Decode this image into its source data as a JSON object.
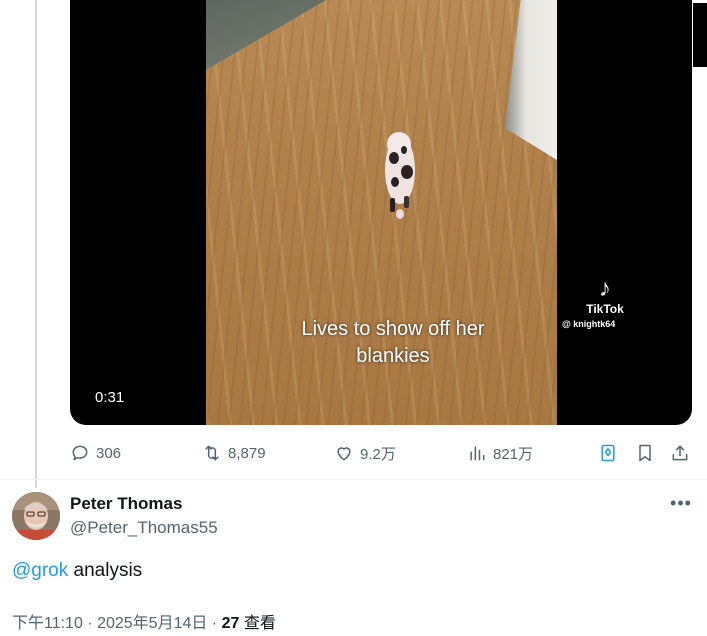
{
  "video": {
    "caption": "Lives to show off her blankies",
    "watermark_name": "TikTok",
    "watermark_handle": "@ knightk64",
    "duration": "0:31"
  },
  "actions": {
    "replies": "306",
    "reposts": "8,879",
    "likes": "9.2万",
    "views": "821万"
  },
  "reply": {
    "author_name": "Peter Thomas",
    "author_handle": "@Peter_Thomas55",
    "mention": "@grok",
    "text": " analysis",
    "timestamp": "下午11:10 · 2025年5月14日 · ",
    "views_count": "27",
    "views_label": " 查看"
  },
  "colors": {
    "accent": "#1d9bf0",
    "secondary_text": "#536471",
    "primary_text": "#0f1419"
  },
  "icons": {
    "reply": "reply-icon",
    "repost": "repost-icon",
    "like": "heart-icon",
    "views": "bar-chart-icon",
    "grok": "grok-icon",
    "bookmark": "bookmark-icon",
    "share": "share-icon",
    "more": "more-icon"
  }
}
